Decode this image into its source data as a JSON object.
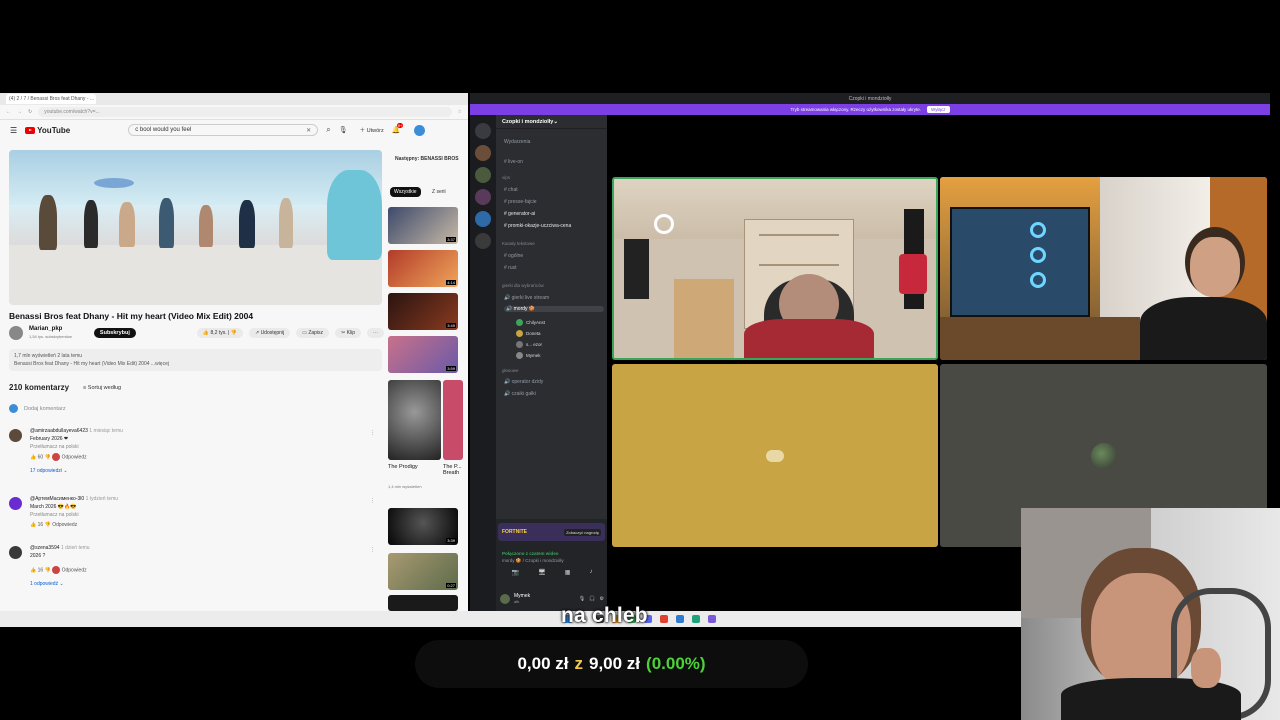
{
  "youtube": {
    "tab_title": "(4) 2 / 7 / Benassi Bros feat Dhany - ...",
    "url": "youtube.com/watch?v=...",
    "logo": "YouTube",
    "search_value": "c bool would you feel",
    "create_label": "Utwórz",
    "notif_count": "9+",
    "video_title": "Benassi Bros feat Dhany - Hit my heart (Video Mix Edit) 2004",
    "channel_name": "Marian_pkp",
    "channel_subs": "1,54 tys. subskrybentów",
    "subscribe_label": "Subskrybuj",
    "likes": "8,2 tys.",
    "share_label": "Udostępnij",
    "save_label": "Zapisz",
    "clip_label": "Klip",
    "views_line": "1,7 mln wyświetleń  2 lata temu",
    "desc_line": "Benassi Bros feat Dhany - Hit my heart (Video Mix Edit) 2004 ...więcej",
    "comments_count": "210 komentarzy",
    "sort_label": "Sortuj według",
    "add_comment": "Dodaj komentarz",
    "comments": [
      {
        "author": "@amirzaabdullayeva6423",
        "time": "1 miesiąc temu",
        "text": "February 2026 ❤",
        "translate": "Przetłumacz na polski",
        "likes": "60",
        "reply": "Odpowiedz",
        "replies": "17 odpowiedzi"
      },
      {
        "author": "@АртемМасименко-3l0",
        "time": "1 tydzień temu",
        "text": "March 2026 😎🔥😎",
        "translate": "Przetłumacz na polski",
        "likes": "16",
        "reply": "Odpowiedz",
        "replies": ""
      },
      {
        "author": "@szena3594",
        "time": "1 dzień temu",
        "text": "2026 ?",
        "translate": "",
        "likes": "16",
        "reply": "Odpowiedz",
        "replies": "1 odpowiedź"
      }
    ],
    "next_label": "Następny: BENASSI BROS",
    "chip_all": "Wszystkie",
    "chip_series": "Z serii",
    "thumb_durations": [
      "3:37",
      "4:14",
      "3:49",
      "3:59",
      "",
      "3:39",
      "0:27"
    ],
    "big_thumbs": [
      {
        "title": "The Prodigy",
        "meta": "1,4 mln wyświetleń"
      },
      {
        "title": "The P... Breath",
        "meta": "420 tys. wyśw."
      }
    ]
  },
  "discord": {
    "window_title": "Czopki i mondziołły",
    "banner_text": "Tryb streamowania włączony. Rzeczy użytkownika zostały ukryte.",
    "banner_button": "Wyłącz",
    "server_name": "Czopki i mondziolły",
    "events": "Wydarzenia",
    "channels": [
      "live-on",
      "vips",
      "chat",
      "presse-fajcie",
      "generator-ai",
      "promki-okazje-uczciwa-cena"
    ],
    "text_cat": "Kanały tekstowe",
    "text_channels": [
      "ogólne",
      "rust"
    ],
    "voice_cat": "gierki dla wybrańców",
    "voice_channels": [
      "gierki live stream",
      "mordy 🍪"
    ],
    "voice_users": [
      "ChilyAnst",
      "Doneta",
      "s... ezor",
      "Mymek"
    ],
    "voice_cat2": "głosowe",
    "voice_channels2": [
      "operator dzidy",
      "czaiki gałki"
    ],
    "fortnite_label": "FORTNITE",
    "fortnite_btn": "Zobaczyć nagrodę",
    "connected": "Połączono z czatem wideo",
    "connected_sub": "mordy 🍪 / Czopki i mondziolły",
    "user_name": "Mymek",
    "user_status": "afk"
  },
  "overlay": {
    "caption": "na chleb",
    "donation_current": "0,00 zł",
    "donation_sep": "z",
    "donation_goal": "9,00 zł",
    "donation_pct": "(0.00%)"
  },
  "colors": {
    "discord_banner": "#7b3fe4",
    "yt_red": "#ee0000",
    "tile_yellow": "#c9a445",
    "donation_gold": "#f2c94c",
    "donation_green": "#4cd137"
  }
}
